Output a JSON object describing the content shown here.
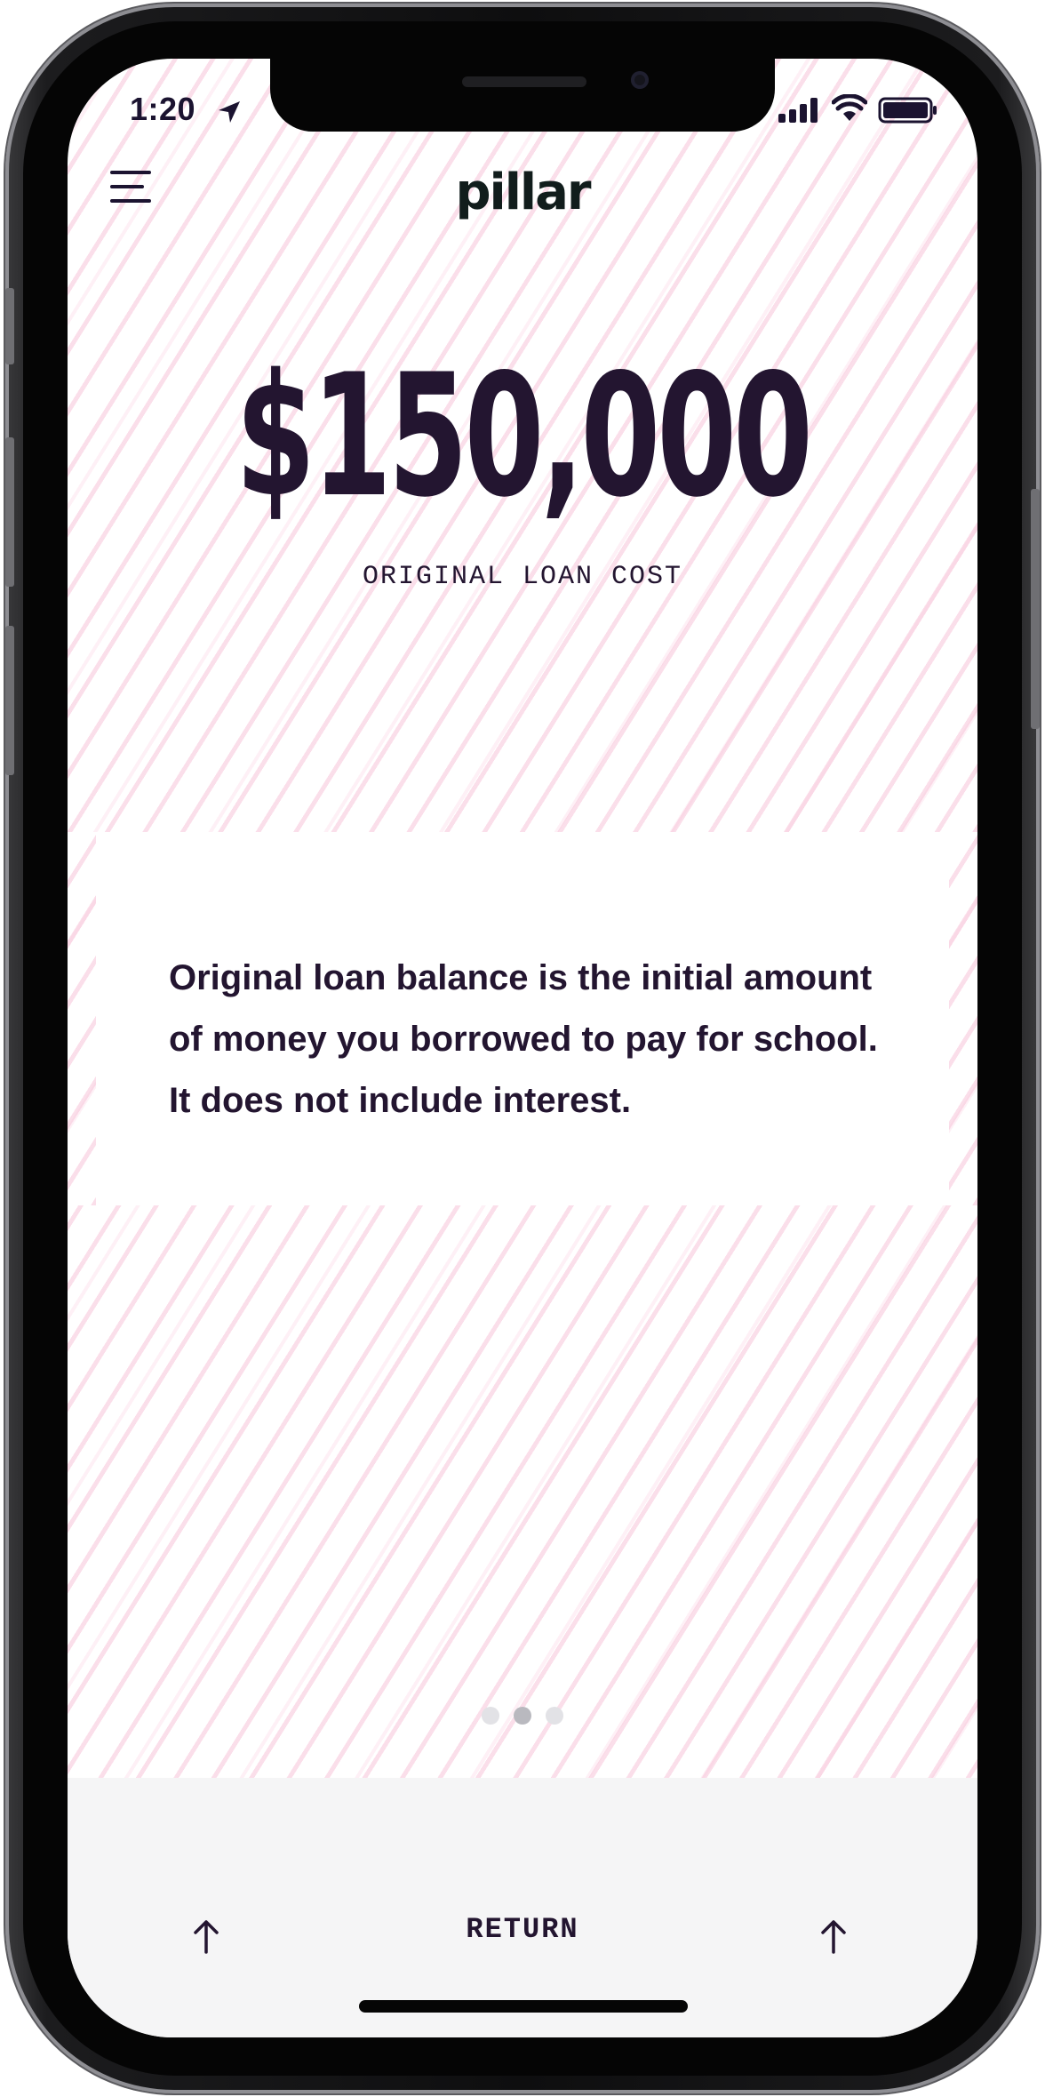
{
  "status_bar": {
    "time": "1:20",
    "icons": [
      "location-arrow-icon",
      "cellular-signal-icon",
      "wifi-icon",
      "battery-icon"
    ]
  },
  "header": {
    "menu_icon": "hamburger-menu-icon",
    "logo_text": "pillar"
  },
  "main": {
    "amount": "$150,000",
    "amount_label": "ORIGINAL LOAN COST",
    "description": "Original loan balance is the initial amount of money you borrowed to pay for school. It does not include interest."
  },
  "pagination": {
    "total": 3,
    "active_index": 1
  },
  "bottom_bar": {
    "left_icon": "arrow-up-icon",
    "return_label": "RETURN",
    "right_icon": "arrow-up-icon"
  },
  "colors": {
    "text_primary": "#231530",
    "pattern": "#f7c4d8",
    "bottom_bar": "#f5f5f6",
    "dot_active": "#b9b9bf",
    "dot_inactive": "#e2e2e6"
  }
}
